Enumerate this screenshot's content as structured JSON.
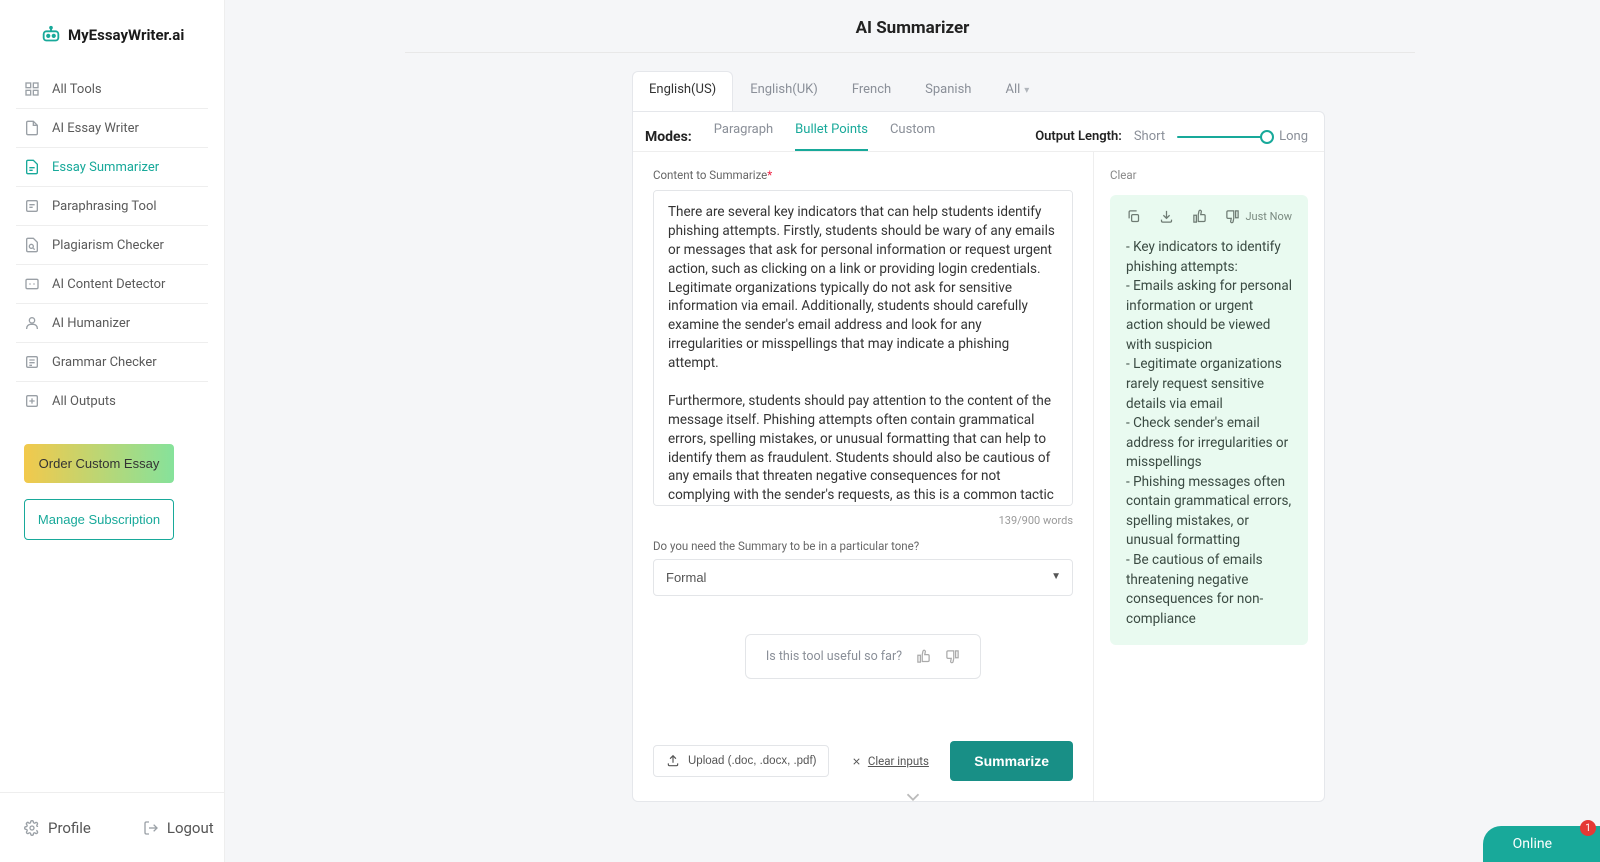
{
  "brand": "MyEssayWriter.ai",
  "sidebar": {
    "items": [
      {
        "label": "All Tools"
      },
      {
        "label": "AI Essay Writer"
      },
      {
        "label": "Essay Summarizer"
      },
      {
        "label": "Paraphrasing Tool"
      },
      {
        "label": "Plagiarism Checker"
      },
      {
        "label": "AI Content Detector"
      },
      {
        "label": "AI Humanizer"
      },
      {
        "label": "Grammar Checker"
      },
      {
        "label": "All Outputs"
      }
    ],
    "order_btn": "Order Custom Essay",
    "manage_btn": "Manage Subscription",
    "profile": "Profile",
    "logout": "Logout"
  },
  "page": {
    "title": "AI Summarizer"
  },
  "lang_tabs": {
    "us": "English(US)",
    "uk": "English(UK)",
    "fr": "French",
    "es": "Spanish",
    "all": "All"
  },
  "modes": {
    "label": "Modes:",
    "paragraph": "Paragraph",
    "bullet": "Bullet Points",
    "custom": "Custom"
  },
  "outlen": {
    "label": "Output Length:",
    "short": "Short",
    "long": "Long"
  },
  "input": {
    "label": "Content to Summarize",
    "text": "There are several key indicators that can help students identify phishing attempts. Firstly, students should be wary of any emails or messages that ask for personal information or request urgent action, such as clicking on a link or providing login credentials. Legitimate organizations typically do not ask for sensitive information via email. Additionally, students should carefully examine the sender's email address and look for any irregularities or misspellings that may indicate a phishing attempt.\n\nFurthermore, students should pay attention to the content of the message itself. Phishing attempts often contain grammatical errors, spelling mistakes, or unusual formatting that can help to identify them as fraudulent. Students should also be cautious of any emails that threaten negative consequences for not complying with the sender's requests, as this is a common tactic used by phishers to create a sense of urgency.",
    "wordcount": "139/900 words",
    "tone_label": "Do you need the Summary to be in a particular tone?",
    "tone_value": "Formal"
  },
  "useful": {
    "q": "Is this tool useful so far?"
  },
  "footer": {
    "upload": "Upload (.doc, .docx, .pdf)",
    "clear": "Clear inputs",
    "summarize": "Summarize"
  },
  "output": {
    "clear": "Clear",
    "timestamp": "Just Now",
    "bullets": [
      "- Key indicators to identify phishing attempts:",
      "- Emails asking for personal information or urgent action should be viewed with suspicion",
      "- Legitimate organizations rarely request sensitive details via email",
      "- Check sender's email address for irregularities or misspellings",
      "- Phishing messages often contain grammatical errors, spelling mistakes, or unusual formatting",
      "- Be cautious of emails threatening negative consequences for non-compliance"
    ]
  },
  "online": {
    "label": "Online",
    "badge": "1"
  }
}
